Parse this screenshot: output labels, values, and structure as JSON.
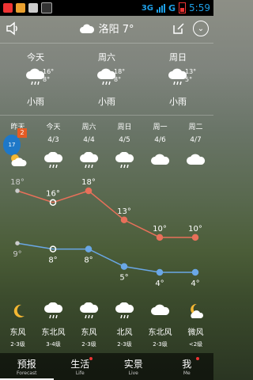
{
  "status": {
    "network": "3G",
    "signal_type": "G",
    "time": "5:59"
  },
  "header": {
    "title": "洛阳 7°"
  },
  "summary": [
    {
      "day": "今天",
      "high": "16°",
      "low": "8°",
      "desc": "小雨"
    },
    {
      "day": "周六",
      "high": "18°",
      "low": "8°",
      "desc": "小雨"
    },
    {
      "day": "周日",
      "high": "13°",
      "low": "5°",
      "desc": "小雨"
    }
  ],
  "forecast": {
    "days": [
      "昨天",
      "今天",
      "周六",
      "周日",
      "周一",
      "周二"
    ],
    "dates": [
      "",
      "4/3",
      "4/4",
      "4/5",
      "4/6",
      "4/7"
    ],
    "high_labels": [
      "18°",
      "16°",
      "18°",
      "13°",
      "10°",
      "10°"
    ],
    "low_labels": [
      "9°",
      "8°",
      "8°",
      "5°",
      "4°",
      "4°"
    ],
    "winds": [
      "东风",
      "东北风",
      "东风",
      "北风",
      "东北风",
      "微风"
    ],
    "levels": [
      "2-3级",
      "3-4级",
      "2-3级",
      "2-3级",
      "2-3级",
      "<2级"
    ]
  },
  "chart_data": {
    "type": "line",
    "categories": [
      "昨天",
      "今天",
      "周六",
      "周日",
      "周一",
      "周二"
    ],
    "series": [
      {
        "name": "",
        "values": [
          18,
          16,
          18,
          13,
          10,
          10
        ]
      },
      {
        "name": "",
        "values": [
          9,
          8,
          8,
          5,
          4,
          4
        ]
      }
    ],
    "colors": [
      "#e8705a",
      "#6aa7e6"
    ]
  },
  "avatar": {
    "badge": "2",
    "label": "17"
  },
  "tabs": [
    {
      "zh": "预报",
      "en": "Forecast"
    },
    {
      "zh": "生活",
      "en": "Life"
    },
    {
      "zh": "实景",
      "en": "Live"
    },
    {
      "zh": "我",
      "en": "Me"
    }
  ]
}
